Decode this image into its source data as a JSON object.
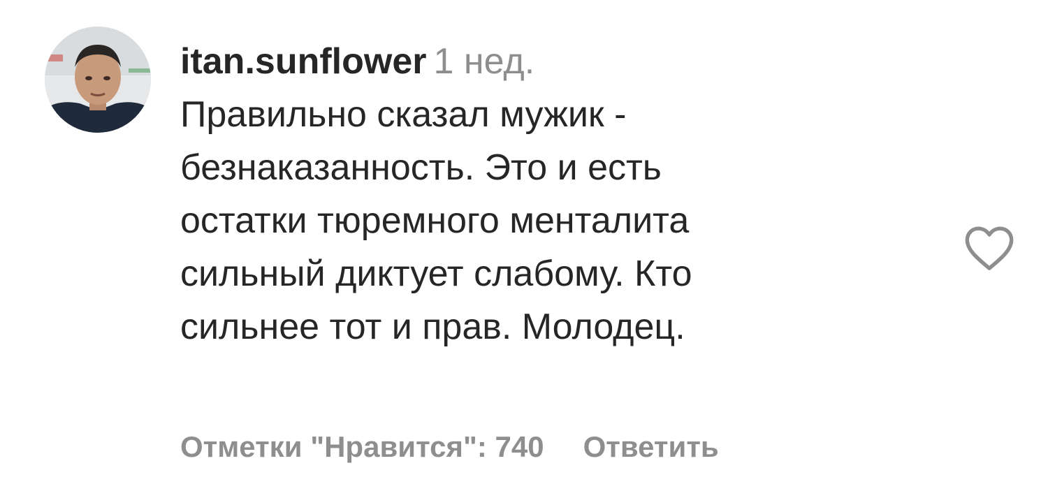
{
  "comment": {
    "username": "itan.sunflower",
    "time": "1 нед.",
    "text_lines": [
      "Правильно сказал мужик -",
      "безнаказанность. Это и есть",
      "остатки тюремного менталита",
      "сильный диктует слабому. Кто",
      "сильнее тот и прав. Молодец."
    ],
    "likes_label": "Отметки \"Нравится\": 740",
    "reply_label": "Ответить",
    "like_icon": "heart-outline-icon"
  },
  "colors": {
    "text": "#262626",
    "secondary": "#8e8e8e"
  }
}
